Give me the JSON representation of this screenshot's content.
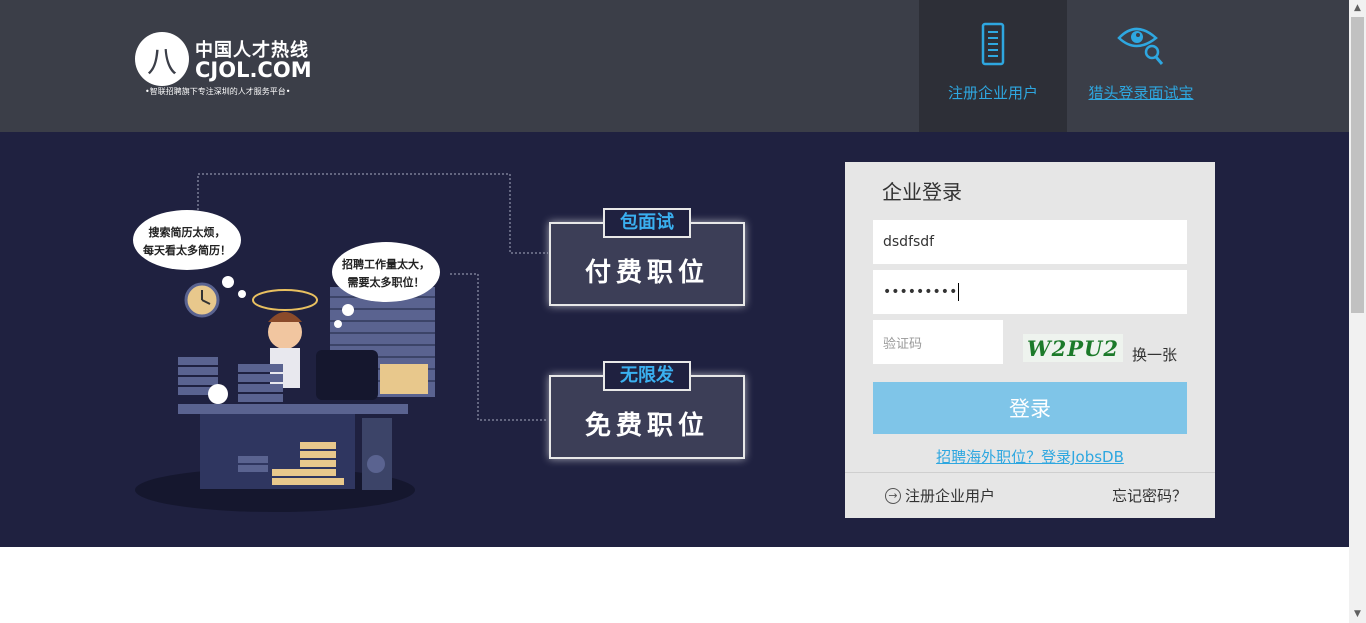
{
  "header": {
    "logo": {
      "mark": "八",
      "cn": "中国人才热线",
      "en": "CJOL.COM",
      "tagline": "•智联招聘旗下专注深圳的人才服务平台•"
    },
    "nav": {
      "register": "注册企业用户",
      "headhunter": "猎头登录面试宝"
    }
  },
  "hero": {
    "bubble_left": [
      "搜索简历太烦，",
      "每天看太多简历！"
    ],
    "bubble_right": [
      "招聘工作量太大，",
      "需要太多职位！"
    ],
    "badge_paid": {
      "tag": "包面试",
      "main": "付费职位"
    },
    "badge_free": {
      "tag": "无限发",
      "main": "免费职位"
    }
  },
  "login": {
    "title": "企业登录",
    "username_value": "dsdfsdf",
    "password_mask": "•••••••••",
    "captcha_placeholder": "验证码",
    "captcha_text": "W2PU2",
    "captcha_refresh": "换一张",
    "submit": "登录",
    "jobsdb_link": "招聘海外职位？登录JobsDB",
    "register_link": "注册企业用户",
    "forgot_link": "忘记密码？"
  },
  "colors": {
    "header_bg": "#3b3e48",
    "hero_bg": "#1f2140",
    "accent": "#2ea7e0",
    "login_button": "#7fc5e8",
    "login_panel": "#e6e6e6"
  },
  "icons": [
    "building-icon",
    "eye-magnifier-icon",
    "arrow-circle-icon",
    "chevron-up-icon",
    "chevron-down-icon"
  ]
}
